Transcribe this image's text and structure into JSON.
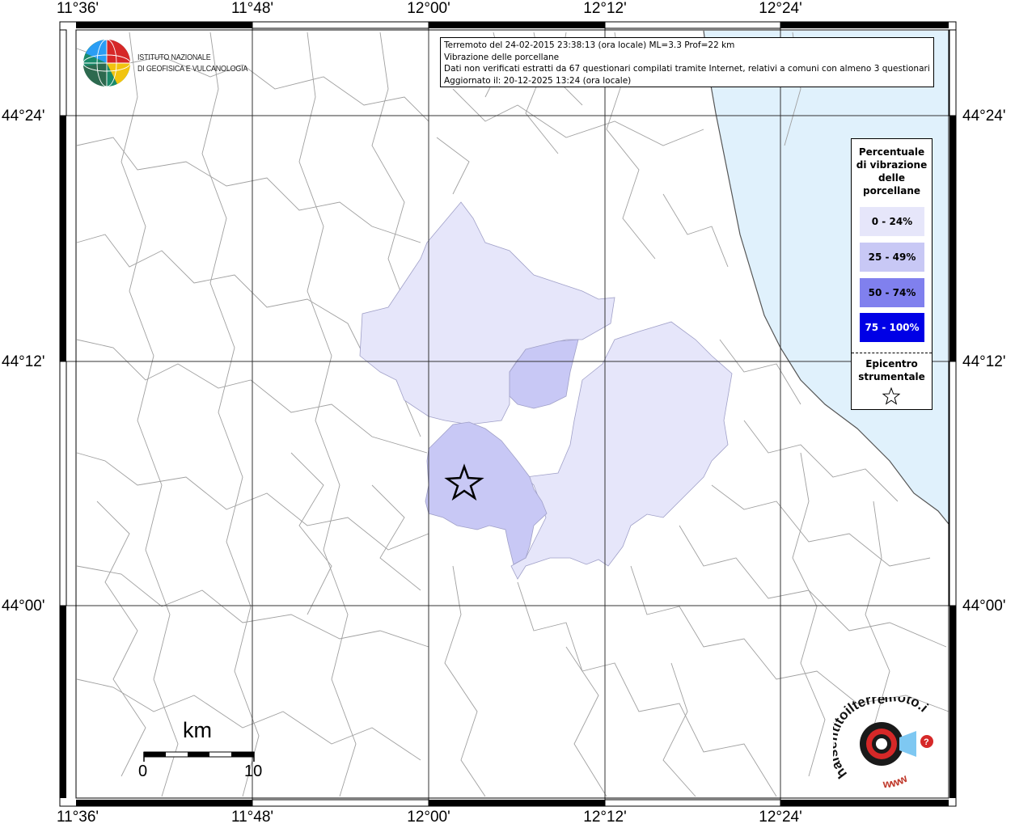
{
  "map": {
    "lon_labels": [
      "11°36'",
      "11°48'",
      "12°00'",
      "12°12'",
      "12°24'"
    ],
    "lat_labels": [
      "44°24'",
      "44°12'",
      "44°00'"
    ]
  },
  "info": {
    "line1": "Terremoto del 24-02-2015 23:38:13 (ora locale) ML=3.3 Prof=22 km",
    "line2": "Vibrazione delle porcellane",
    "line3": "Dati non verificati estratti da 67 questionari compilati tramite Internet, relativi a comuni con almeno 3 questionari.",
    "line4": "Aggiornato il: 20-12-2025 13:24 (ora locale)"
  },
  "logo": {
    "name_line1": "ISTITUTO NAZIONALE",
    "name_line2": "DI GEOFISICA E VULCANOLOGIA"
  },
  "legend": {
    "title_lines": [
      "Percentuale",
      "di vibrazione",
      "delle",
      "porcellane"
    ],
    "classes": [
      {
        "label": "0 - 24%",
        "color": "#e6e6fa",
        "text_color": "#000000"
      },
      {
        "label": "25 - 49%",
        "color": "#c8c8f5",
        "text_color": "#000000"
      },
      {
        "label": "50 - 74%",
        "color": "#8080ee",
        "text_color": "#000000"
      },
      {
        "label": "75 - 100%",
        "color": "#0000e6",
        "text_color": "#ffffff"
      }
    ],
    "epicenter_lines": [
      "Epicentro",
      "strumentale"
    ]
  },
  "scale": {
    "unit": "km",
    "start": "0",
    "end": "10"
  },
  "hst_logo": {
    "text": "haisentitoilterremoto.it",
    "www": "www"
  },
  "colors": {
    "sea": "#e0f1fc",
    "boundary": "#9a9a9a",
    "grid": "#333333",
    "class_0_24": "#e6e6fa",
    "class_25_49": "#c8c8f5"
  }
}
